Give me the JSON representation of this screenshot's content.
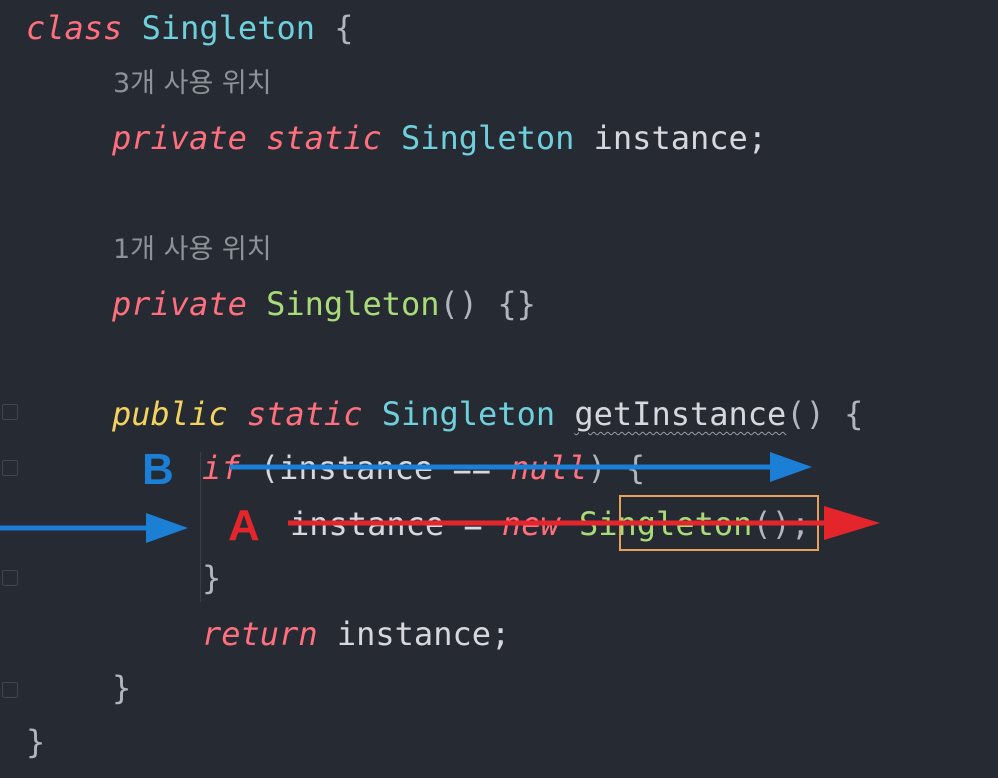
{
  "code": {
    "class_kw": "class",
    "class_name": "Singleton",
    "open_brace": "{",
    "hint1": "3개 사용 위치",
    "field_private": "private",
    "field_static": "static",
    "field_type": "Singleton",
    "field_rest": "instance;",
    "hint2": "1개 사용 위치",
    "ctor_private": "private",
    "ctor_name": "Singleton",
    "ctor_rest": "() {}",
    "m_public": "public",
    "m_static": "static",
    "m_type": "Singleton",
    "m_name": "getInstance",
    "m_rest": "() {",
    "if_kw": "if",
    "if_open": "(instance ",
    "if_eq": "==",
    "if_null": "null",
    "if_close": ") {",
    "assign_pre": "instance = ",
    "assign_new": "new",
    "assign_cls": "Singleton",
    "assign_end": "();",
    "if_close_brace": "}",
    "ret_kw": "return",
    "ret_rest": "instance;",
    "m_close_brace": "}",
    "class_close_brace": "}"
  },
  "annotations": {
    "label_b": "B",
    "label_a": "A",
    "blue_color": "#1c7fd6",
    "red_color": "#e4262c",
    "box_color": "#e6a15c"
  }
}
